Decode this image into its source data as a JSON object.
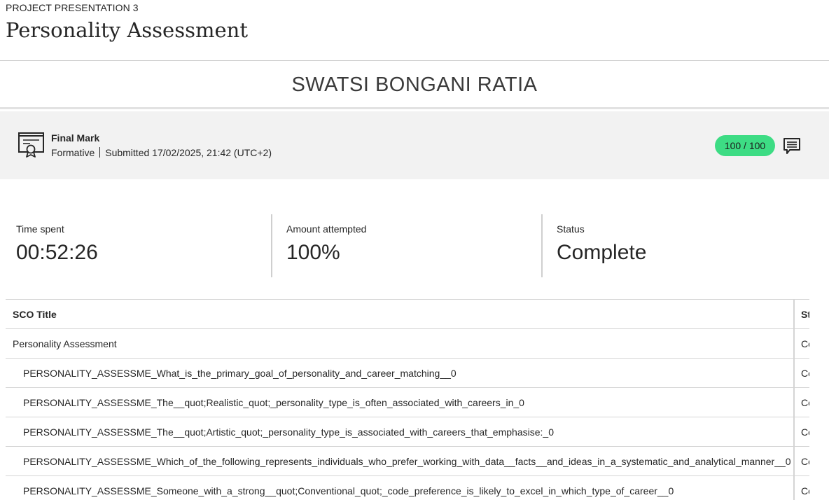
{
  "header": {
    "eyebrow": "PROJECT PRESENTATION 3",
    "title": "Personality Assessment"
  },
  "student": {
    "name": "SWATSI BONGANI RATIA"
  },
  "final_mark": {
    "title": "Final Mark",
    "type": "Formative",
    "submitted": "Submitted 17/02/2025, 21:42 (UTC+2)",
    "score": "100 / 100",
    "score_color": "#3ddc84",
    "icon": "certificate-icon",
    "feedback_icon": "comment-icon"
  },
  "stats": [
    {
      "label": "Time spent",
      "value": "00:52:26"
    },
    {
      "label": "Amount attempted",
      "value": "100%"
    },
    {
      "label": "Status",
      "value": "Complete"
    }
  ],
  "table": {
    "columns": [
      "SCO Title",
      "St"
    ],
    "rows": [
      {
        "title": "Personality Assessment",
        "status": "Co"
      },
      {
        "title": "PERSONALITY_ASSESSME_What_is_the_primary_goal_of_personality_and_career_matching__0",
        "status": "Co"
      },
      {
        "title": "PERSONALITY_ASSESSME_The__quot;Realistic_quot;_personality_type_is_often_associated_with_careers_in_0",
        "status": "Co"
      },
      {
        "title": "PERSONALITY_ASSESSME_The__quot;Artistic_quot;_personality_type_is_associated_with_careers_that_emphasise:_0",
        "status": "Co"
      },
      {
        "title": "PERSONALITY_ASSESSME_Which_of_the_following_represents_individuals_who_prefer_working_with_data__facts__and_ideas_in_a_systematic_and_analytical_manner__0",
        "status": "Co"
      },
      {
        "title": "PERSONALITY_ASSESSME_Someone_with_a_strong__quot;Conventional_quot;_code_preference_is_likely_to_excel_in_which_type_of_career__0",
        "status": "Co"
      }
    ]
  }
}
